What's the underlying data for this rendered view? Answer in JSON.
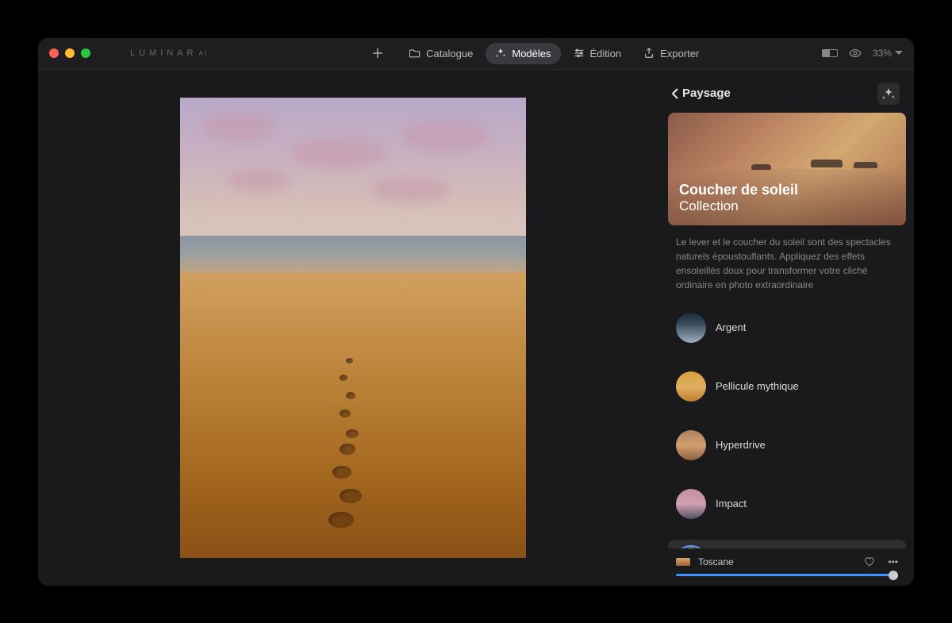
{
  "brand": "LUMINAR",
  "brand_suffix": "AI",
  "nav": {
    "catalogue": "Catalogue",
    "modeles": "Modèles",
    "edition": "Édition",
    "exporter": "Exporter"
  },
  "zoom": "33%",
  "sidebar": {
    "back_label": "Paysage",
    "hero_title": "Coucher de soleil",
    "hero_subtitle": "Collection",
    "description": "Le lever et le coucher du soleil sont des spectacles naturels époustouflants. Appliquez des effets ensoleillés doux pour transformer votre cliché ordinaire en photo extraordinaire",
    "presets": [
      {
        "label": "Argent",
        "thumb_bg": "linear-gradient(180deg,#1a2a3a 0%,#3a5060 40%,#a0b0c0 100%)"
      },
      {
        "label": "Pellicule mythique",
        "thumb_bg": "linear-gradient(180deg,#d4a040 0%,#e0b060 50%,#c08030 100%)"
      },
      {
        "label": "Hyperdrive",
        "thumb_bg": "linear-gradient(180deg,#b08060 0%,#d0a070 50%,#906040 100%)"
      },
      {
        "label": "Impact",
        "thumb_bg": "linear-gradient(180deg,#c090a0 0%,#d0a0b0 50%,#505060 100%)"
      },
      {
        "label": "Toscane",
        "thumb_bg": "linear-gradient(180deg,#e8b878 0%,#d09850 50%,#a06830 100%)"
      }
    ],
    "applied_label": "Toscane"
  }
}
